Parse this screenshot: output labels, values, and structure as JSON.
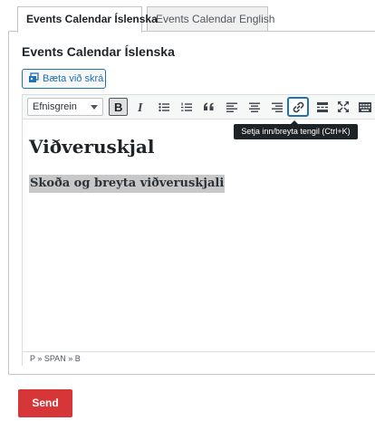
{
  "tabs": [
    {
      "label": "Events Calendar Íslenska",
      "active": true
    },
    {
      "label": "Events Calendar English",
      "active": false
    }
  ],
  "panel": {
    "title": "Events Calendar Íslenska"
  },
  "add_media": {
    "label": "Bæta við skrá",
    "icon": "add-media-icon"
  },
  "toolbar": {
    "format_select": {
      "value": "Efnisgrein"
    },
    "buttons": [
      {
        "name": "bold",
        "icon": "bold-icon",
        "state": "pressed"
      },
      {
        "name": "italic",
        "icon": "italic-icon"
      },
      {
        "name": "bulleted-list",
        "icon": "bullet-list-icon"
      },
      {
        "name": "numbered-list",
        "icon": "numbered-list-icon"
      },
      {
        "name": "blockquote",
        "icon": "blockquote-icon"
      },
      {
        "name": "align-left",
        "icon": "align-left-icon"
      },
      {
        "name": "align-center",
        "icon": "align-center-icon"
      },
      {
        "name": "align-right",
        "icon": "align-right-icon"
      },
      {
        "name": "link",
        "icon": "link-icon",
        "state": "focused"
      },
      {
        "name": "read-more",
        "icon": "read-more-icon"
      },
      {
        "name": "fullscreen",
        "icon": "fullscreen-icon"
      },
      {
        "name": "toolbar-toggle",
        "icon": "kitchen-sink-icon"
      }
    ]
  },
  "tooltip": {
    "text": "Setja inn/breyta tengil (Ctrl+K)"
  },
  "content": {
    "heading": "Viðveruskjal",
    "paragraph": "Skoða og breyta viðveruskjali"
  },
  "statusbar": {
    "path": "P » SPAN » B"
  },
  "send_button": {
    "label": "Send"
  },
  "colors": {
    "accent": "#2271b1",
    "danger": "#d63638",
    "tooltip_bg": "#1d2327",
    "highlight": "#c8c8c8"
  }
}
